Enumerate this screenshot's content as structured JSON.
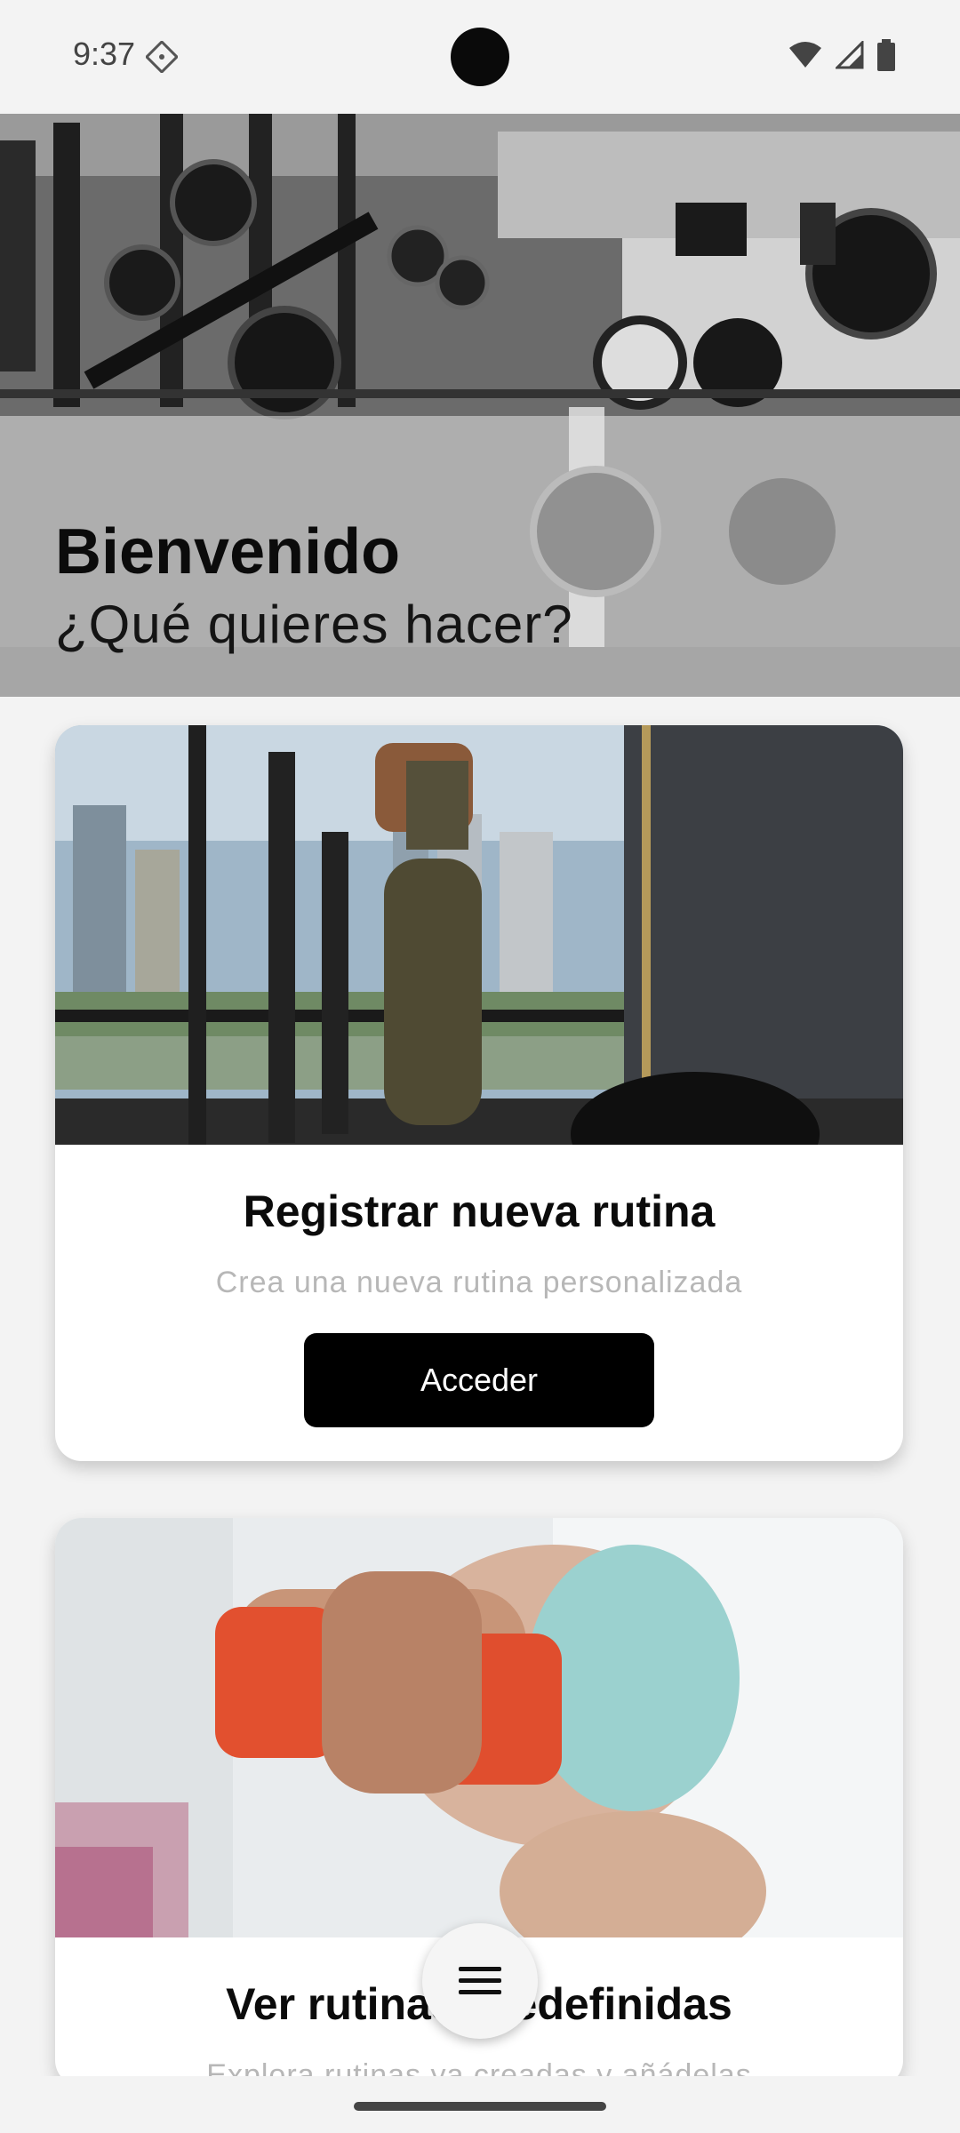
{
  "status_bar": {
    "time": "9:37",
    "icons": [
      "app-notification-icon",
      "wifi-icon",
      "signal-icon",
      "battery-icon"
    ]
  },
  "hero": {
    "title": "Bienvenido",
    "subtitle": "¿Qué quieres hacer?"
  },
  "cards": [
    {
      "title": "Registrar nueva rutina",
      "description": "Crea una nueva rutina personalizada",
      "button_label": "Acceder"
    },
    {
      "title": "Ver rutinas predefinidas",
      "description": "Explora rutinas ya creadas y añádelas"
    }
  ],
  "fab": {
    "icon": "menu-icon"
  },
  "colors": {
    "background": "#f3f3f3",
    "card": "#ffffff",
    "button": "#000000",
    "button_text": "#ffffff",
    "muted_text": "#b7b7b7"
  }
}
